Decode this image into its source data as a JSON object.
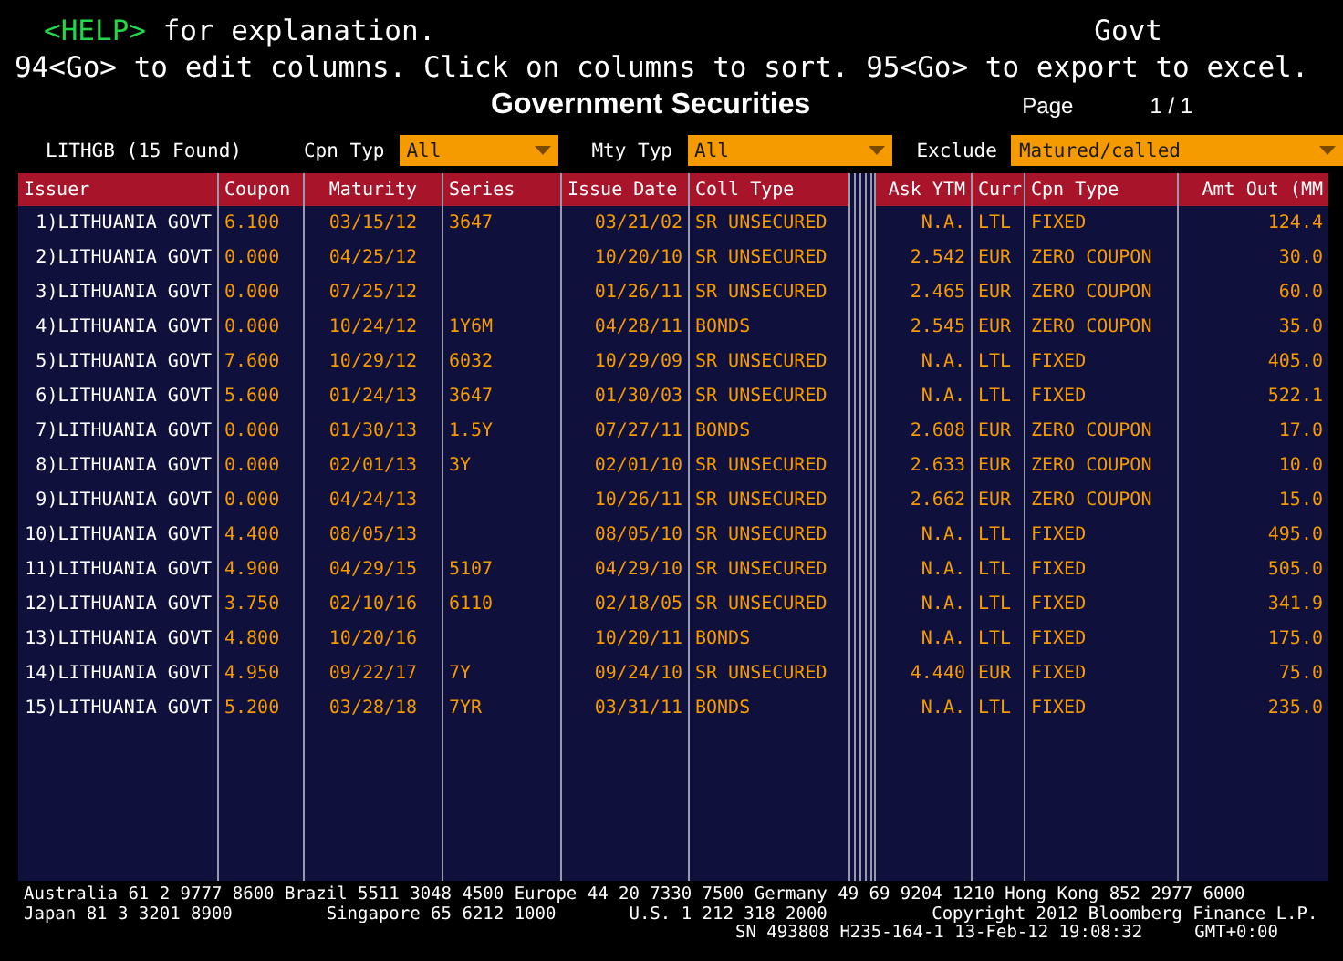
{
  "help_bar": {
    "key": "<HELP>",
    "text": "for explanation.",
    "market": "Govt"
  },
  "instructions": "94<Go> to edit columns. Click on columns to sort. 95<Go> to export to excel.",
  "title": "Government Securities",
  "page": {
    "label": "Page",
    "value": "1 / 1"
  },
  "found": "LITHGB (15 Found)",
  "filters": [
    {
      "label": "Cpn Typ",
      "value": "All"
    },
    {
      "label": "Mty Typ",
      "value": "All"
    },
    {
      "label": "Exclude",
      "value": "Matured/called"
    }
  ],
  "table": {
    "columns": [
      "Issuer",
      "Coupon",
      "Maturity",
      "Series",
      "Issue Date",
      "Coll Type",
      "Ask YTM",
      "Curr",
      "Cpn Type",
      "Amt Out (MM"
    ],
    "rows": [
      {
        "issuer": "1)LITHUANIA GOVT",
        "coupon": "6.100",
        "maturity": "03/15/12",
        "series": "3647",
        "issue_date": "03/21/02",
        "coll_type": "SR UNSECURED",
        "ask_ytm": "N.A.",
        "curr": "LTL",
        "cpn_type": "FIXED",
        "amt_out": "124.4"
      },
      {
        "issuer": "2)LITHUANIA GOVT",
        "coupon": "0.000",
        "maturity": "04/25/12",
        "issue_date": "10/20/10",
        "coll_type": "SR UNSECURED",
        "ask_ytm": "2.542",
        "curr": "EUR",
        "cpn_type": "ZERO COUPON",
        "amt_out": "30.0"
      },
      {
        "issuer": "3)LITHUANIA GOVT",
        "coupon": "0.000",
        "maturity": "07/25/12",
        "issue_date": "01/26/11",
        "coll_type": "SR UNSECURED",
        "ask_ytm": "2.465",
        "curr": "EUR",
        "cpn_type": "ZERO COUPON",
        "amt_out": "60.0"
      },
      {
        "issuer": "4)LITHUANIA GOVT",
        "coupon": "0.000",
        "maturity": "10/24/12",
        "series": "1Y6M",
        "issue_date": "04/28/11",
        "coll_type": "BONDS",
        "ask_ytm": "2.545",
        "curr": "EUR",
        "cpn_type": "ZERO COUPON",
        "amt_out": "35.0"
      },
      {
        "issuer": "5)LITHUANIA GOVT",
        "coupon": "7.600",
        "maturity": "10/29/12",
        "series": "6032",
        "issue_date": "10/29/09",
        "coll_type": "SR UNSECURED",
        "ask_ytm": "N.A.",
        "curr": "LTL",
        "cpn_type": "FIXED",
        "amt_out": "405.0"
      },
      {
        "issuer": "6)LITHUANIA GOVT",
        "coupon": "5.600",
        "maturity": "01/24/13",
        "series": "3647",
        "issue_date": "01/30/03",
        "coll_type": "SR UNSECURED",
        "ask_ytm": "N.A.",
        "curr": "LTL",
        "cpn_type": "FIXED",
        "amt_out": "522.1"
      },
      {
        "issuer": "7)LITHUANIA GOVT",
        "coupon": "0.000",
        "maturity": "01/30/13",
        "series": "1.5Y",
        "issue_date": "07/27/11",
        "coll_type": "BONDS",
        "ask_ytm": "2.608",
        "curr": "EUR",
        "cpn_type": "ZERO COUPON",
        "amt_out": "17.0"
      },
      {
        "issuer": "8)LITHUANIA GOVT",
        "coupon": "0.000",
        "maturity": "02/01/13",
        "series": "3Y",
        "issue_date": "02/01/10",
        "coll_type": "SR UNSECURED",
        "ask_ytm": "2.633",
        "curr": "EUR",
        "cpn_type": "ZERO COUPON",
        "amt_out": "10.0"
      },
      {
        "issuer": "9)LITHUANIA GOVT",
        "coupon": "0.000",
        "maturity": "04/24/13",
        "issue_date": "10/26/11",
        "coll_type": "SR UNSECURED",
        "ask_ytm": "2.662",
        "curr": "EUR",
        "cpn_type": "ZERO COUPON",
        "amt_out": "15.0"
      },
      {
        "issuer": "10)LITHUANIA GOVT",
        "coupon": "4.400",
        "maturity": "08/05/13",
        "issue_date": "08/05/10",
        "coll_type": "SR UNSECURED",
        "ask_ytm": "N.A.",
        "curr": "LTL",
        "cpn_type": "FIXED",
        "amt_out": "495.0"
      },
      {
        "issuer": "11)LITHUANIA GOVT",
        "coupon": "4.900",
        "maturity": "04/29/15",
        "series": "5107",
        "issue_date": "04/29/10",
        "coll_type": "SR UNSECURED",
        "ask_ytm": "N.A.",
        "curr": "LTL",
        "cpn_type": "FIXED",
        "amt_out": "505.0"
      },
      {
        "issuer": "12)LITHUANIA GOVT",
        "coupon": "3.750",
        "maturity": "02/10/16",
        "series": "6110",
        "issue_date": "02/18/05",
        "coll_type": "SR UNSECURED",
        "ask_ytm": "N.A.",
        "curr": "LTL",
        "cpn_type": "FIXED",
        "amt_out": "341.9"
      },
      {
        "issuer": "13)LITHUANIA GOVT",
        "coupon": "4.800",
        "maturity": "10/20/16",
        "issue_date": "10/20/11",
        "coll_type": "BONDS",
        "ask_ytm": "N.A.",
        "curr": "LTL",
        "cpn_type": "FIXED",
        "amt_out": "175.0"
      },
      {
        "issuer": "14)LITHUANIA GOVT",
        "coupon": "4.950",
        "maturity": "09/22/17",
        "series": "7Y",
        "issue_date": "09/24/10",
        "coll_type": "SR UNSECURED",
        "ask_ytm": "4.440",
        "curr": "EUR",
        "cpn_type": "FIXED",
        "amt_out": "75.0"
      },
      {
        "issuer": "15)LITHUANIA GOVT",
        "coupon": "5.200",
        "maturity": "03/28/18",
        "series": "7YR",
        "issue_date": "03/31/11",
        "coll_type": "BONDS",
        "ask_ytm": "N.A.",
        "curr": "LTL",
        "cpn_type": "FIXED",
        "amt_out": "235.0"
      }
    ]
  },
  "footer": [
    "Australia 61 2 9777 8600 Brazil 5511 3048 4500 Europe 44 20 7330 7500 Germany 49 69 9204 1210 Hong Kong 852 2977 6000",
    "Japan 81 3 3201 8900         Singapore 65 6212 1000       U.S. 1 212 318 2000          Copyright 2012 Bloomberg Finance L.P.",
    "SN 493808 H235-164-1 13-Feb-12 19:08:32     GMT+0:00"
  ]
}
